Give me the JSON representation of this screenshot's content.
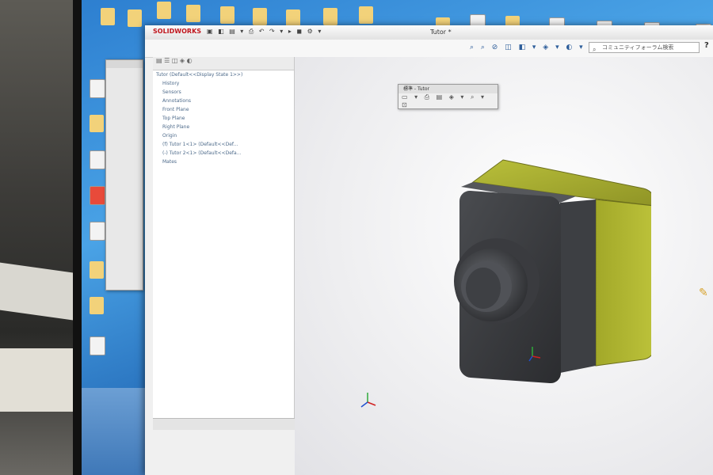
{
  "app": {
    "logo_text": "SOLIDWORKS",
    "document_title": "Tutor *",
    "search_placeholder": "コミュニティフォーラム検索",
    "help_label": "?"
  },
  "floating_toolbar": {
    "title": "標準 - Tutor"
  },
  "feature_tree": {
    "tabs_label": "▤ ☰ ◫ ◈ ◐",
    "items": [
      "Tutor (Default<<Display State 1>>)",
      "History",
      "Sensors",
      "Annotations",
      "Front Plane",
      "Top Plane",
      "Right Plane",
      "Origin",
      "(f) Tutor 1<1> (Default<<Def...",
      "(-) Tutor 2<1> (Default<<Defa...",
      "Mates"
    ]
  },
  "colors": {
    "brand_red": "#c0161d",
    "body_dark": "#3a3c3f",
    "body_yellow": "#a8ae2e",
    "desktop_blue": "#2d7fd0"
  },
  "icons": [
    "solidworks-logo-icon",
    "search-icon",
    "help-icon",
    "rotate-view-icon",
    "zoom-icon",
    "section-view-icon",
    "display-style-icon",
    "cursor-icon",
    "triad-icon",
    "folder-icon"
  ]
}
